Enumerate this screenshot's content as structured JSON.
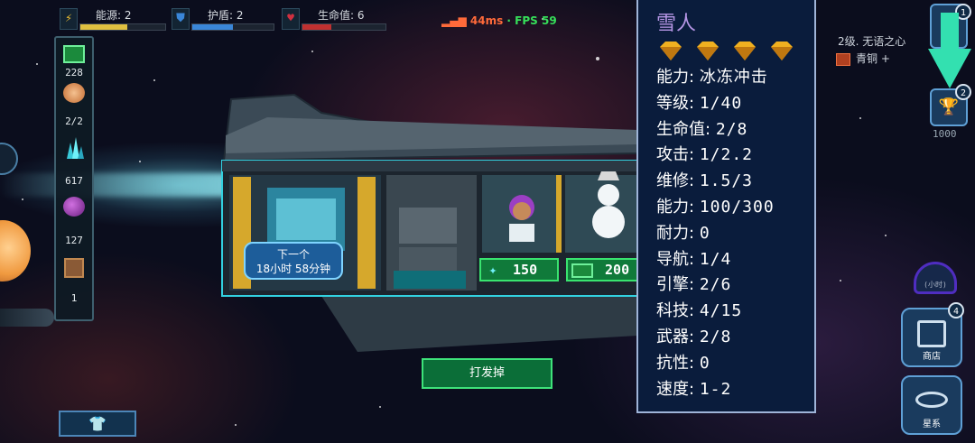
{
  "top_stats": {
    "power": {
      "label": "能源: 2",
      "fill": 0.55,
      "color": "#e0c040"
    },
    "shield": {
      "label": "护盾: 2",
      "fill": 0.5,
      "color": "#3a86d8"
    },
    "hp": {
      "label": "生命值: 6",
      "fill": 0.35,
      "color": "#c03030"
    }
  },
  "network": {
    "ping": "44ms",
    "separator": "·",
    "fps": "FPS 59"
  },
  "resources": {
    "gas": "228",
    "crew": "2/2",
    "crystal": "617",
    "orb": "127",
    "crate": "1"
  },
  "timer_pill": {
    "line1": "下一个",
    "line2": "18小时 58分钟"
  },
  "buy_tags": [
    {
      "value": "150",
      "icon": "crystal-icon"
    },
    {
      "value": "200",
      "icon": "cash-icon"
    }
  ],
  "fire_button": "打发掉",
  "crew_info": {
    "name": "雪人",
    "stats": [
      {
        "label": "能力:",
        "value": "冰冻冲击"
      },
      {
        "label": "等级:",
        "value": "1/40"
      },
      {
        "label": "生命值:",
        "value": "2/8"
      },
      {
        "label": "攻击:",
        "value": "1/2.2"
      },
      {
        "label": "维修:",
        "value": "1.5/3"
      },
      {
        "label": "能力:",
        "value": "100/300"
      },
      {
        "label": "耐力:",
        "value": "0"
      },
      {
        "label": "导航:",
        "value": "1/4"
      },
      {
        "label": "引擎:",
        "value": "2/6"
      },
      {
        "label": "科技:",
        "value": "4/15"
      },
      {
        "label": "武器:",
        "value": "2/8"
      },
      {
        "label": "抗性:",
        "value": "0"
      },
      {
        "label": "速度:",
        "value": "1-2"
      }
    ],
    "rarity": "diamond",
    "stars": 4
  },
  "player_rank": {
    "tier": "2级. 无语之心",
    "league": "青铜 +"
  },
  "side_badges": {
    "top": "1",
    "trophy": "2",
    "trophy_value": "1000",
    "shop": "4"
  },
  "side_buttons": {
    "shop": "商店",
    "galaxy": "星系"
  },
  "gauge_label": "(小时)"
}
